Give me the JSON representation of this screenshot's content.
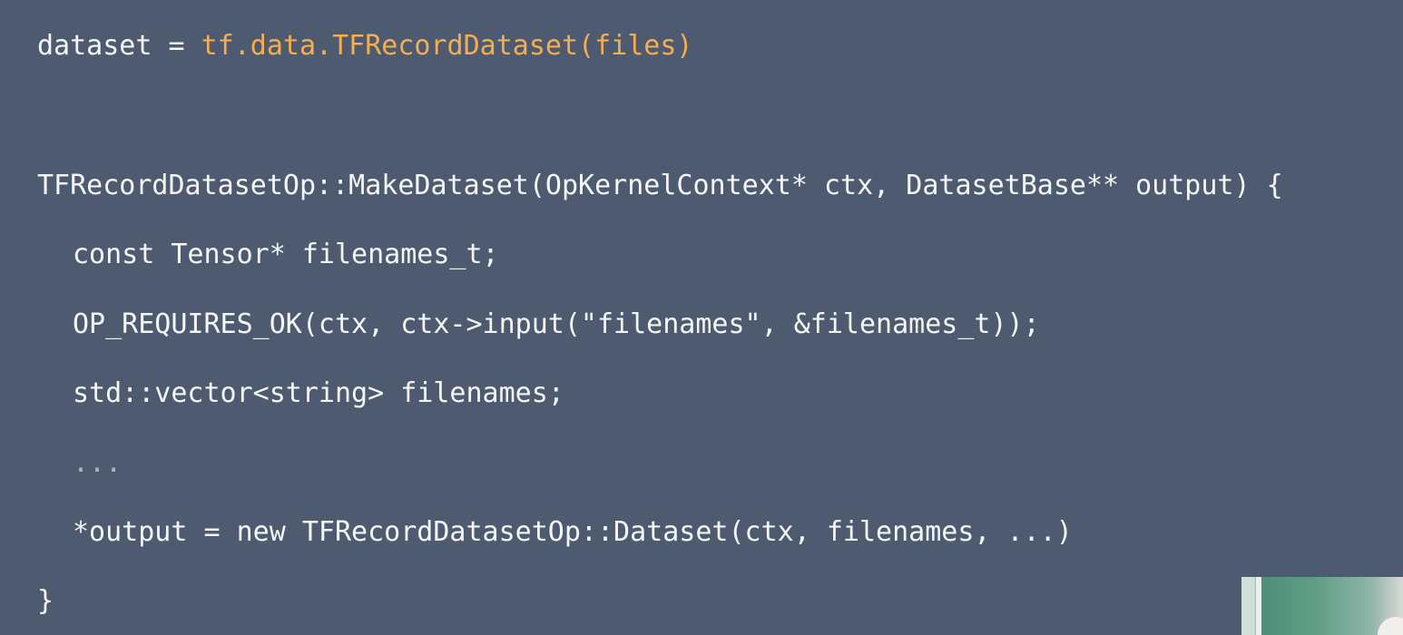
{
  "code": {
    "line1_prefix": "dataset = ",
    "line1_call": "tf.data.TFRecordDataset(files)",
    "line2": "TFRecordDatasetOp::MakeDataset(OpKernelContext* ctx, DatasetBase** output) {",
    "line3": "const Tensor* filenames_t;",
    "line4": "OP_REQUIRES_OK(ctx, ctx->input(\"filenames\", &filenames_t));",
    "line5": "std::vector<string> filenames;",
    "line6": "...",
    "line7": "*output = new TFRecordDatasetOp::Dataset(ctx, filenames, ...)",
    "line8": "}"
  },
  "colors": {
    "background": "#4d5a6f",
    "text": "#f4f6f8",
    "accent": "#f4ae4f"
  }
}
